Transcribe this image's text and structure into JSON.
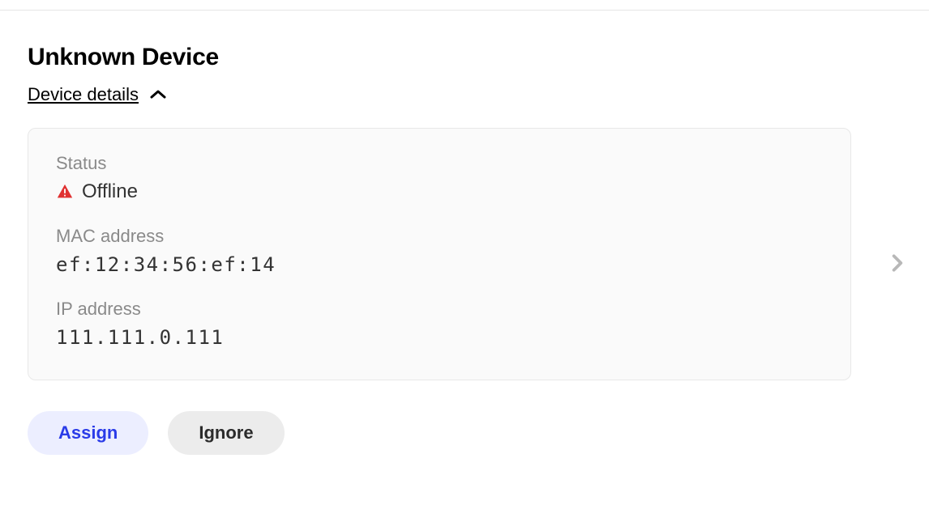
{
  "device": {
    "title": "Unknown Device",
    "details_toggle_label": "Device details",
    "status_label": "Status",
    "status_value": "Offline",
    "mac_label": "MAC address",
    "mac_value": "ef:12:34:56:ef:14",
    "ip_label": "IP address",
    "ip_value": "111.111.0.111"
  },
  "buttons": {
    "assign": "Assign",
    "ignore": "Ignore"
  }
}
